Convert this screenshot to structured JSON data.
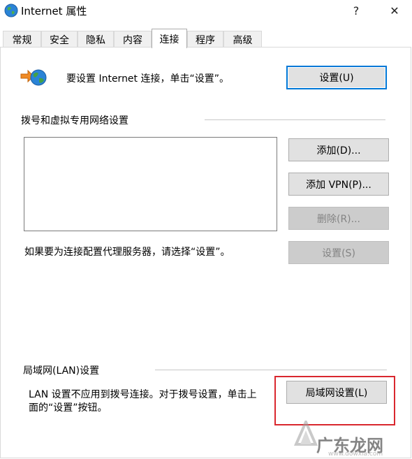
{
  "window": {
    "title": "Internet 属性",
    "help_label": "?",
    "close_label": "✕"
  },
  "tabs": [
    {
      "label": "常规"
    },
    {
      "label": "安全"
    },
    {
      "label": "隐私"
    },
    {
      "label": "内容"
    },
    {
      "label": "连接",
      "active": true
    },
    {
      "label": "程序"
    },
    {
      "label": "高级"
    }
  ],
  "setup": {
    "text": "要设置 Internet 连接，单击“设置”。",
    "button_label": "设置(U)"
  },
  "dialup": {
    "heading": "拨号和虚拟专用网络设置",
    "add_button": "添加(D)...",
    "add_vpn_button": "添加 VPN(P)...",
    "remove_button": "删除(R)...",
    "proxy_text": "如果要为连接配置代理服务器，请选择“设置”。",
    "settings_button": "设置(S)"
  },
  "lan": {
    "heading": "局域网(LAN)设置",
    "text_line1": "LAN 设置不应用到拨号连接。对于拨号设置，单击上",
    "text_line2": "面的“设置”按钮。",
    "button_label": "局域网设置(L)"
  },
  "watermark": {
    "text": "广东龙网",
    "url_text": "www.dowxia.com"
  },
  "colors": {
    "highlight_box": "#d9272e",
    "primary_border": "#0078d7"
  }
}
